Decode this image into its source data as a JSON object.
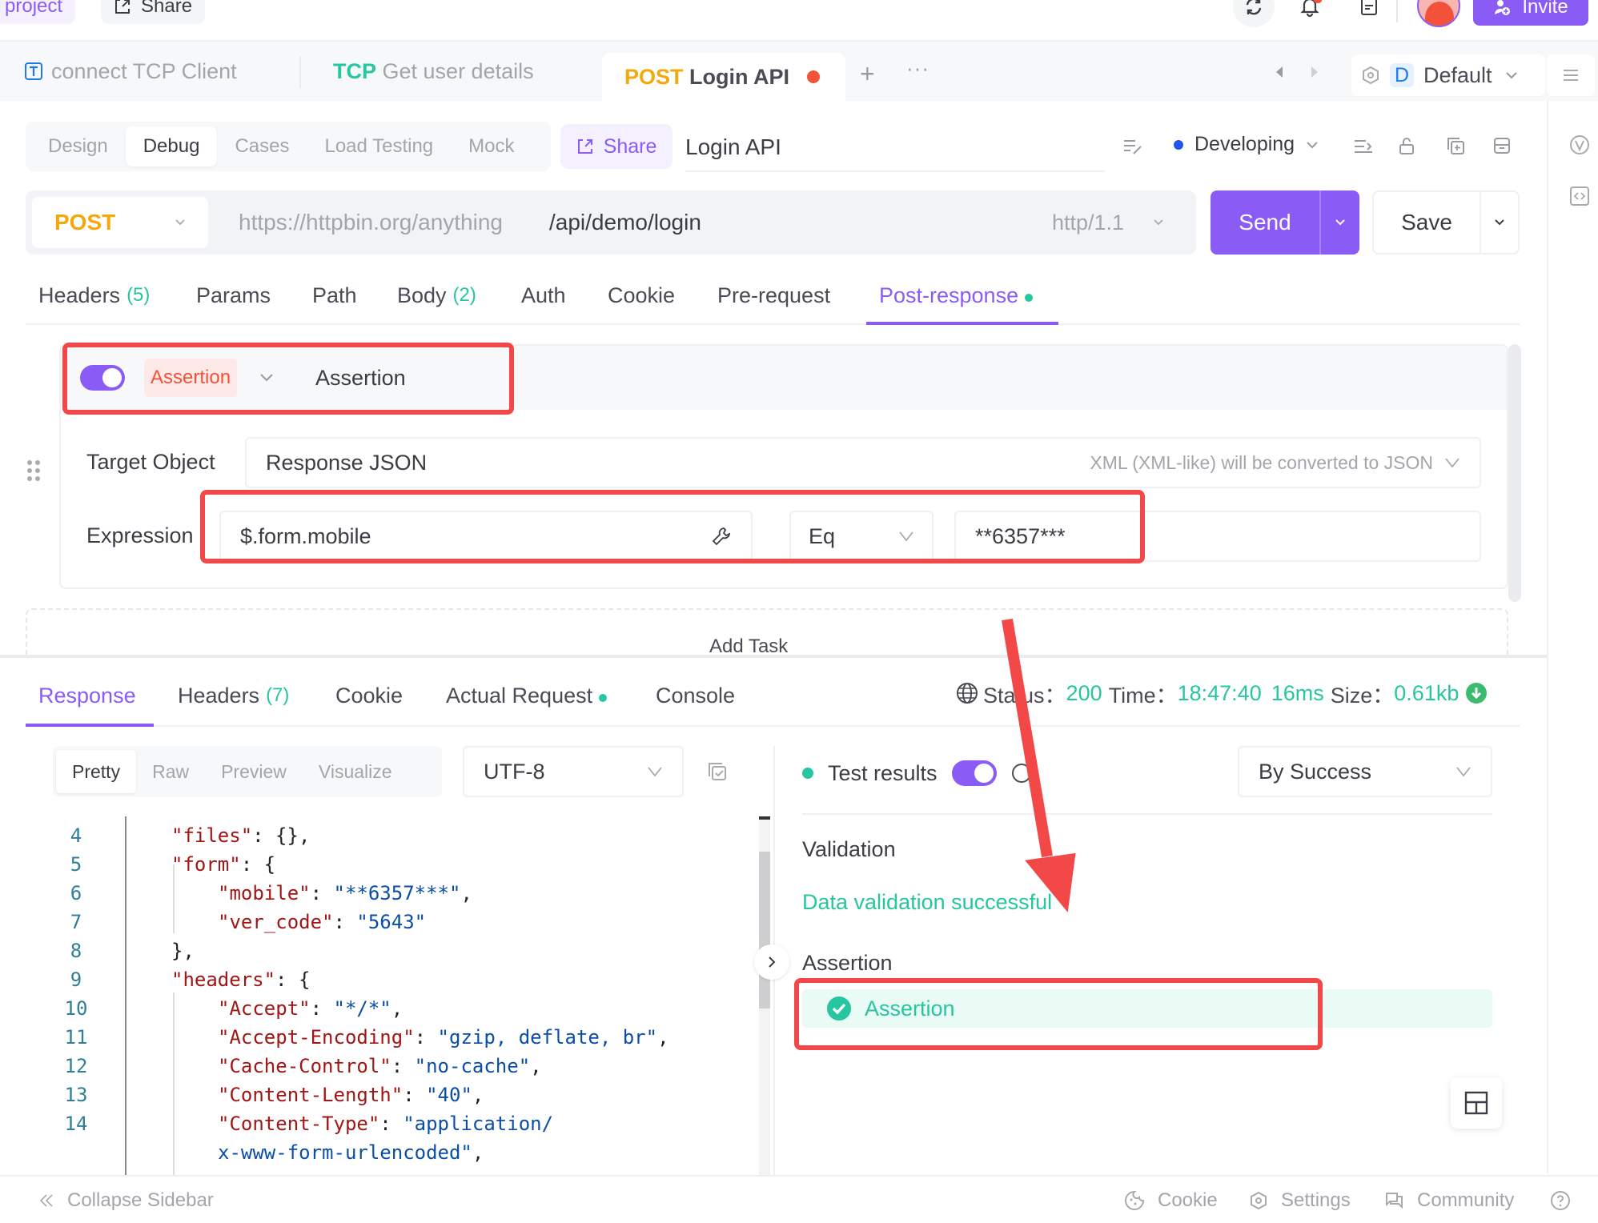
{
  "topbar": {
    "project_label": "project",
    "share_label": "Share",
    "invite_label": "Invite",
    "icons": [
      "refresh-icon",
      "bell-icon",
      "notes-icon",
      "avatar",
      "invite-user-icon"
    ]
  },
  "doc_tabs": [
    {
      "prefix": "",
      "label": "connect TCP Client",
      "icon": "tcp-client-icon",
      "active": false
    },
    {
      "prefix": "TCP",
      "label": "Get user details",
      "active": false
    },
    {
      "prefix": "POST",
      "label": "Login API",
      "active": true,
      "unsaved": true
    }
  ],
  "environment": {
    "badge": "D",
    "name": "Default"
  },
  "mode_tabs": [
    "Design",
    "Debug",
    "Cases",
    "Load Testing",
    "Mock"
  ],
  "mode_active": "Debug",
  "share_button": "Share",
  "api_name": "Login API",
  "api_status": "Developing",
  "request": {
    "method": "POST",
    "base_url": "https://httpbin.org/anything",
    "path": "/api/demo/login",
    "http_version": "http/1.1",
    "send_label": "Send",
    "save_label": "Save"
  },
  "request_tabs": [
    {
      "label": "Headers",
      "count": "(5)"
    },
    {
      "label": "Params"
    },
    {
      "label": "Path"
    },
    {
      "label": "Body",
      "count": "(2)"
    },
    {
      "label": "Auth"
    },
    {
      "label": "Cookie"
    },
    {
      "label": "Pre-request"
    },
    {
      "label": "Post-response",
      "active": true,
      "dot": true
    }
  ],
  "assertion": {
    "enabled": true,
    "type_label": "Assertion",
    "name": "Assertion",
    "target_label": "Target Object",
    "target_value": "Response JSON",
    "target_hint": "XML (XML-like) will be converted to JSON",
    "expression_label": "Expression",
    "expression_value": "$.form.mobile",
    "operator": "Eq",
    "expected": "**6357***",
    "add_task_label": "Add Task"
  },
  "response_tabs": [
    {
      "label": "Response",
      "active": true
    },
    {
      "label": "Headers",
      "count": "(7)"
    },
    {
      "label": "Cookie"
    },
    {
      "label": "Actual Request",
      "dot": true
    },
    {
      "label": "Console"
    }
  ],
  "response_meta": {
    "status_label": "Status：",
    "status": "200",
    "time_label": "Time：",
    "time": "18:47:40",
    "duration": "16ms",
    "size_label": "Size：",
    "size": "0.61kb"
  },
  "view_tabs": [
    "Pretty",
    "Raw",
    "Preview",
    "Visualize"
  ],
  "view_active": "Pretty",
  "encoding": "UTF-8",
  "code_lines": [
    {
      "n": "4",
      "indent": 1,
      "parts": [
        [
          "k",
          "\"files\""
        ],
        [
          "p",
          ": {},"
        ]
      ]
    },
    {
      "n": "5",
      "indent": 1,
      "parts": [
        [
          "k",
          "\"form\""
        ],
        [
          "p",
          ": {"
        ]
      ]
    },
    {
      "n": "6",
      "indent": 2,
      "parts": [
        [
          "k",
          "\"mobile\""
        ],
        [
          "p",
          ": "
        ],
        [
          "s",
          "\"**6357***\""
        ],
        [
          "p",
          ","
        ]
      ]
    },
    {
      "n": "7",
      "indent": 2,
      "parts": [
        [
          "k",
          "\"ver_code\""
        ],
        [
          "p",
          ": "
        ],
        [
          "s",
          "\"5643\""
        ]
      ]
    },
    {
      "n": "8",
      "indent": 1,
      "parts": [
        [
          "p",
          "},"
        ]
      ]
    },
    {
      "n": "9",
      "indent": 1,
      "parts": [
        [
          "k",
          "\"headers\""
        ],
        [
          "p",
          ": {"
        ]
      ]
    },
    {
      "n": "10",
      "indent": 2,
      "parts": [
        [
          "k",
          "\"Accept\""
        ],
        [
          "p",
          ": "
        ],
        [
          "s",
          "\"*/*\""
        ],
        [
          "p",
          ","
        ]
      ]
    },
    {
      "n": "11",
      "indent": 2,
      "parts": [
        [
          "k",
          "\"Accept-Encoding\""
        ],
        [
          "p",
          ": "
        ],
        [
          "s",
          "\"gzip, deflate, br\""
        ],
        [
          "p",
          ","
        ]
      ]
    },
    {
      "n": "12",
      "indent": 2,
      "parts": [
        [
          "k",
          "\"Cache-Control\""
        ],
        [
          "p",
          ": "
        ],
        [
          "s",
          "\"no-cache\""
        ],
        [
          "p",
          ","
        ]
      ]
    },
    {
      "n": "13",
      "indent": 2,
      "parts": [
        [
          "k",
          "\"Content-Length\""
        ],
        [
          "p",
          ": "
        ],
        [
          "s",
          "\"40\""
        ],
        [
          "p",
          ","
        ]
      ]
    },
    {
      "n": "14",
      "indent": 2,
      "parts": [
        [
          "k",
          "\"Content-Type\""
        ],
        [
          "p",
          ": "
        ],
        [
          "s",
          "\"application/"
        ]
      ]
    },
    {
      "n": "",
      "indent": 2,
      "parts": [
        [
          "s",
          "x-www-form-urlencoded\""
        ],
        [
          "p",
          ","
        ]
      ]
    }
  ],
  "test_results": {
    "title": "Test results",
    "filter": "By Success",
    "validation_title": "Validation",
    "validation_message": "Data validation successful",
    "assertion_title": "Assertion",
    "assertion_item": "Assertion"
  },
  "footer": {
    "collapse": "Collapse Sidebar",
    "cookie": "Cookie",
    "settings": "Settings",
    "community": "Community"
  },
  "colors": {
    "accent": "#8a5cf5",
    "success": "#26c6a0",
    "method_post": "#f5a80c",
    "annotation": "#f24848"
  }
}
